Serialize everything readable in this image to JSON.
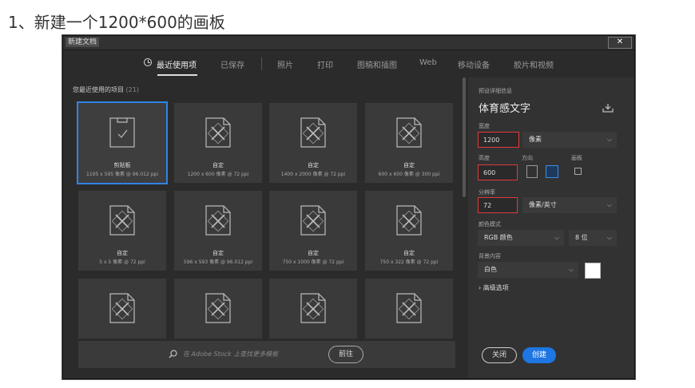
{
  "step_title": "1、新建一个1200*600的画板",
  "window": {
    "title": "新建文档",
    "close_glyph": "✕"
  },
  "tabs": [
    {
      "label": "最近使用项",
      "active": true,
      "icon": "clock-icon"
    },
    {
      "label": "已保存"
    },
    {
      "label": "照片"
    },
    {
      "label": "打印"
    },
    {
      "label": "图稿和插图"
    },
    {
      "label": "Web"
    },
    {
      "label": "移动设备"
    },
    {
      "label": "胶片和视频"
    }
  ],
  "recent": {
    "label": "您最近使用的项目",
    "count": "(21)",
    "items": [
      {
        "name": "剪贴板",
        "dims": "1195 x 595 像素 @ 96.012 ppi",
        "selected": true,
        "icon": "clipboard-doc-icon"
      },
      {
        "name": "自定",
        "dims": "1200 x 600 像素 @ 72 ppi",
        "icon": "custom-doc-icon"
      },
      {
        "name": "自定",
        "dims": "1400 x 2000 像素 @ 72 ppi",
        "icon": "custom-doc-icon"
      },
      {
        "name": "自定",
        "dims": "600 x 600 像素 @ 300 ppi",
        "icon": "custom-doc-icon"
      },
      {
        "name": "自定",
        "dims": "5 x 5 像素 @ 72 ppi",
        "icon": "custom-doc-icon"
      },
      {
        "name": "自定",
        "dims": "596 x 593 像素 @ 96.012 ppi",
        "icon": "custom-doc-icon"
      },
      {
        "name": "自定",
        "dims": "750 x 1000 像素 @ 72 ppi",
        "icon": "custom-doc-icon"
      },
      {
        "name": "自定",
        "dims": "750 x 322 像素 @ 72 ppi",
        "icon": "custom-doc-icon"
      },
      {
        "name": "",
        "dims": "",
        "icon": "custom-doc-icon"
      },
      {
        "name": "",
        "dims": "",
        "icon": "custom-doc-icon"
      },
      {
        "name": "",
        "dims": "",
        "icon": "custom-doc-icon"
      },
      {
        "name": "",
        "dims": "",
        "icon": "custom-doc-icon"
      }
    ]
  },
  "search": {
    "placeholder": "在 Adobe Stock 上查找更多模板",
    "go_label": "前往"
  },
  "preset": {
    "section_label": "预设详细信息",
    "doc_name": "体育感文字",
    "width_label": "宽度",
    "width_value": "1200",
    "width_unit": "像素",
    "height_label": "高度",
    "height_value": "600",
    "orientation_label": "方向",
    "artboard_label": "画板",
    "resolution_label": "分辨率",
    "resolution_value": "72",
    "resolution_unit": "像素/英寸",
    "color_mode_label": "颜色模式",
    "color_mode": "RGB 颜色",
    "bit_depth": "8 位",
    "background_label": "背景内容",
    "background": "白色",
    "background_color": "#ffffff",
    "advanced_label": "高级选项"
  },
  "buttons": {
    "close": "关闭",
    "create": "创建"
  },
  "colors": {
    "accent": "#1e76e3",
    "highlight_border": "#e03a3a"
  }
}
